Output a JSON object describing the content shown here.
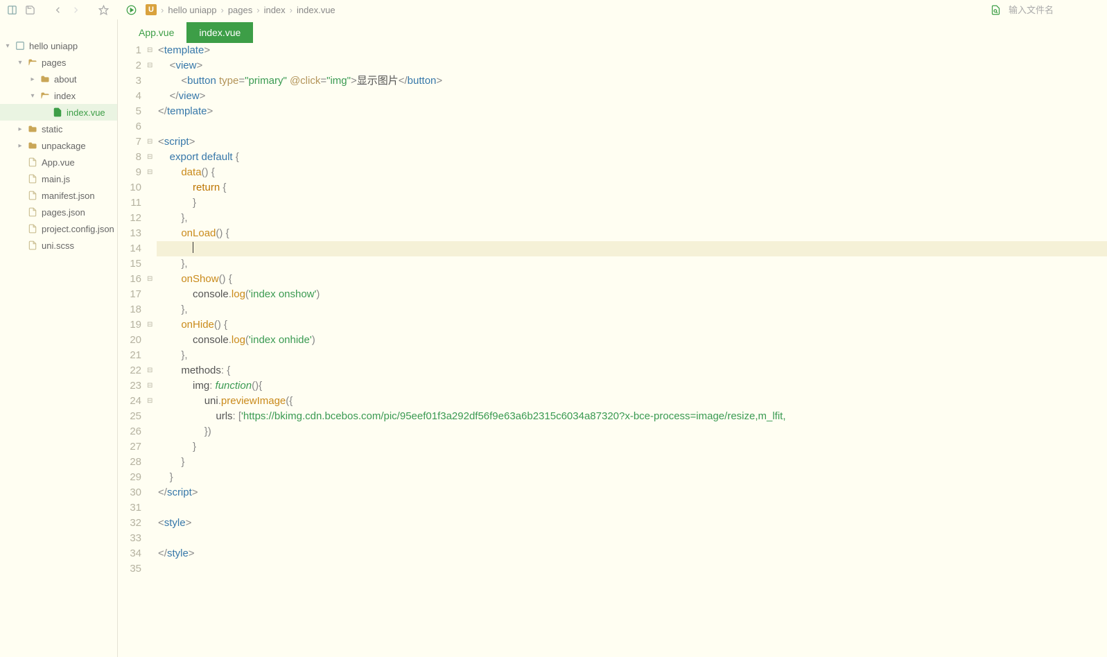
{
  "toolbar": {
    "breadcrumbs": [
      "hello uniapp",
      "pages",
      "index",
      "index.vue"
    ],
    "search_placeholder": "输入文件名"
  },
  "sidebar": {
    "tree": [
      {
        "depth": 0,
        "chev": "v",
        "icon": "project",
        "label": "hello uniapp"
      },
      {
        "depth": 1,
        "chev": "v",
        "icon": "folder-open",
        "label": "pages"
      },
      {
        "depth": 2,
        "chev": ">",
        "icon": "folder",
        "label": "about"
      },
      {
        "depth": 2,
        "chev": "v",
        "icon": "folder-open",
        "label": "index"
      },
      {
        "depth": 3,
        "chev": "",
        "icon": "file-vue",
        "label": "index.vue",
        "selected": true
      },
      {
        "depth": 1,
        "chev": ">",
        "icon": "folder",
        "label": "static"
      },
      {
        "depth": 1,
        "chev": ">",
        "icon": "folder",
        "label": "unpackage"
      },
      {
        "depth": 1,
        "chev": "",
        "icon": "file-vue",
        "label": "App.vue"
      },
      {
        "depth": 1,
        "chev": "",
        "icon": "file-js",
        "label": "main.js"
      },
      {
        "depth": 1,
        "chev": "",
        "icon": "file-json",
        "label": "manifest.json"
      },
      {
        "depth": 1,
        "chev": "",
        "icon": "file-json",
        "label": "pages.json"
      },
      {
        "depth": 1,
        "chev": "",
        "icon": "file-json",
        "label": "project.config.json"
      },
      {
        "depth": 1,
        "chev": "",
        "icon": "file-scss",
        "label": "uni.scss"
      }
    ]
  },
  "tabs": [
    {
      "label": "App.vue",
      "active": false
    },
    {
      "label": "index.vue",
      "active": true
    }
  ],
  "code": {
    "lines": [
      {
        "n": 1,
        "fold": "⊟",
        "html": "<span class='tok-punct'>&lt;</span><span class='tok-tag'>template</span><span class='tok-punct'>&gt;</span>"
      },
      {
        "n": 2,
        "fold": "⊟",
        "html": "    <span class='tok-punct'>&lt;</span><span class='tok-tag'>view</span><span class='tok-punct'>&gt;</span>"
      },
      {
        "n": 3,
        "fold": "",
        "html": "        <span class='tok-punct'>&lt;</span><span class='tok-tag'>button</span> <span class='tok-attr'>type</span><span class='tok-punct'>=</span><span class='tok-str'>\"primary\"</span> <span class='tok-attr'>@click</span><span class='tok-punct'>=</span><span class='tok-str'>\"img\"</span><span class='tok-punct'>&gt;</span><span class='tok-txt'>显示图片</span><span class='tok-punct'>&lt;/</span><span class='tok-tag'>button</span><span class='tok-punct'>&gt;</span>"
      },
      {
        "n": 4,
        "fold": "",
        "html": "    <span class='tok-punct'>&lt;/</span><span class='tok-tag'>view</span><span class='tok-punct'>&gt;</span>"
      },
      {
        "n": 5,
        "fold": "",
        "html": "<span class='tok-punct'>&lt;/</span><span class='tok-tag'>template</span><span class='tok-punct'>&gt;</span>"
      },
      {
        "n": 6,
        "fold": "",
        "html": ""
      },
      {
        "n": 7,
        "fold": "⊟",
        "html": "<span class='tok-punct'>&lt;</span><span class='tok-tag'>script</span><span class='tok-punct'>&gt;</span>"
      },
      {
        "n": 8,
        "fold": "⊟",
        "html": "    <span class='tok-kw'>export</span> <span class='tok-kw'>default</span> <span class='tok-punct'>{</span>"
      },
      {
        "n": 9,
        "fold": "⊟",
        "html": "        <span class='tok-fn'>data</span><span class='tok-punct'>() {</span>"
      },
      {
        "n": 10,
        "fold": "",
        "html": "            <span class='tok-kw2'>return</span> <span class='tok-punct'>{</span>"
      },
      {
        "n": 11,
        "fold": "",
        "html": "            <span class='tok-punct'>}</span>"
      },
      {
        "n": 12,
        "fold": "",
        "html": "        <span class='tok-punct'>},</span>"
      },
      {
        "n": 13,
        "fold": "",
        "html": "        <span class='tok-fn'>onLoad</span><span class='tok-punct'>() {</span>"
      },
      {
        "n": 14,
        "fold": "",
        "hl": true,
        "html": "            <span class='caret'></span>"
      },
      {
        "n": 15,
        "fold": "",
        "html": "        <span class='tok-punct'>},</span>"
      },
      {
        "n": 16,
        "fold": "⊟",
        "html": "        <span class='tok-fn'>onShow</span><span class='tok-punct'>() {</span>"
      },
      {
        "n": 17,
        "fold": "",
        "html": "            <span class='tok-prop'>console</span><span class='tok-punct'>.</span><span class='tok-fn'>log</span><span class='tok-punct'>(</span><span class='tok-str'>'index onshow'</span><span class='tok-punct'>)</span>"
      },
      {
        "n": 18,
        "fold": "",
        "html": "        <span class='tok-punct'>},</span>"
      },
      {
        "n": 19,
        "fold": "⊟",
        "html": "        <span class='tok-fn'>onHide</span><span class='tok-punct'>() {</span>"
      },
      {
        "n": 20,
        "fold": "",
        "html": "            <span class='tok-prop'>console</span><span class='tok-punct'>.</span><span class='tok-fn'>log</span><span class='tok-punct'>(</span><span class='tok-str'>'index onhide'</span><span class='tok-punct'>)</span>"
      },
      {
        "n": 21,
        "fold": "",
        "html": "        <span class='tok-punct'>},</span>"
      },
      {
        "n": 22,
        "fold": "⊟",
        "html": "        <span class='tok-prop'>methods</span><span class='tok-punct'>: {</span>"
      },
      {
        "n": 23,
        "fold": "⊟",
        "html": "            <span class='tok-prop'>img</span><span class='tok-punct'>:</span> <span class='tok-fn2'>function</span><span class='tok-punct'>(){</span>"
      },
      {
        "n": 24,
        "fold": "⊟",
        "html": "                <span class='tok-prop'>uni</span><span class='tok-punct'>.</span><span class='tok-fn'>previewImage</span><span class='tok-punct'>({</span>"
      },
      {
        "n": 25,
        "fold": "",
        "html": "                    <span class='tok-prop'>urls</span><span class='tok-punct'>: [</span><span class='tok-str'>'https://bkimg.cdn.bcebos.com/pic/95eef01f3a292df56f9e63a6b2315c6034a87320?x-bce-process=image/resize,m_lfit,</span>"
      },
      {
        "n": 26,
        "fold": "",
        "html": "                <span class='tok-punct'>})</span>"
      },
      {
        "n": 27,
        "fold": "",
        "html": "            <span class='tok-punct'>}</span>"
      },
      {
        "n": 28,
        "fold": "",
        "html": "        <span class='tok-punct'>}</span>"
      },
      {
        "n": 29,
        "fold": "",
        "html": "    <span class='tok-punct'>}</span>"
      },
      {
        "n": 30,
        "fold": "",
        "html": "<span class='tok-punct'>&lt;/</span><span class='tok-tag'>script</span><span class='tok-punct'>&gt;</span>"
      },
      {
        "n": 31,
        "fold": "",
        "html": ""
      },
      {
        "n": 32,
        "fold": "",
        "html": "<span class='tok-punct'>&lt;</span><span class='tok-tag'>style</span><span class='tok-punct'>&gt;</span>"
      },
      {
        "n": 33,
        "fold": "",
        "html": ""
      },
      {
        "n": 34,
        "fold": "",
        "html": "<span class='tok-punct'>&lt;/</span><span class='tok-tag'>style</span><span class='tok-punct'>&gt;</span>"
      },
      {
        "n": 35,
        "fold": "",
        "html": ""
      }
    ]
  }
}
